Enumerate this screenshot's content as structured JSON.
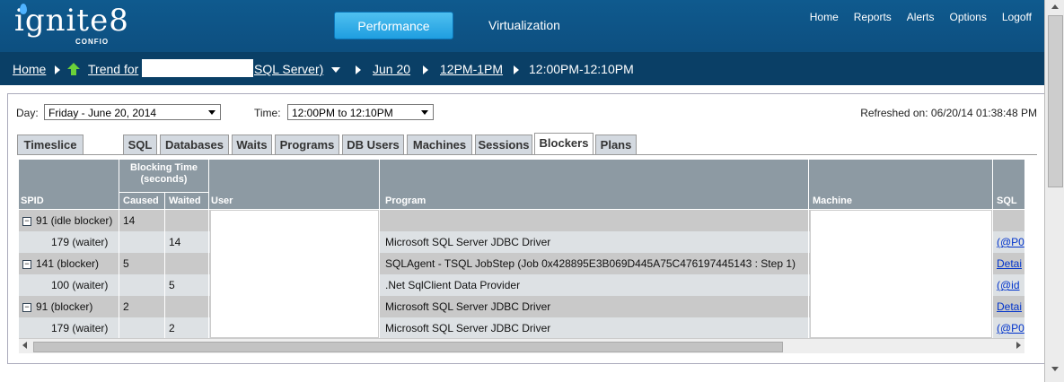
{
  "logo": {
    "word": "ignite8",
    "sub": "CONFIO"
  },
  "nav": {
    "performance": "Performance",
    "virtualization": "Virtualization"
  },
  "top_links": [
    "Home",
    "Reports",
    "Alerts",
    "Options",
    "Logoff"
  ],
  "breadcrumb": {
    "home": "Home",
    "trend": "Trend for",
    "sql": "SQL Server)",
    "day": "Jun 20",
    "hour": "12PM-1PM",
    "slice": "12:00PM-12:10PM"
  },
  "filters": {
    "day_label": "Day:",
    "day_value": "Friday - June 20, 2014",
    "time_label": "Time:",
    "time_value": "12:00PM to 12:10PM",
    "refreshed": "Refreshed on: 06/20/14 01:38:48 PM"
  },
  "tabs": [
    "Timeslice",
    "SQL",
    "Databases",
    "Waits",
    "Programs",
    "DB Users",
    "Machines",
    "Sessions",
    "Blockers",
    "Plans"
  ],
  "active_tab": "Blockers",
  "columns": {
    "spid": "SPID",
    "blocking": "Blocking Time (seconds)",
    "caused": "Caused",
    "waited": "Waited",
    "user": "User",
    "program": "Program",
    "machine": "Machine",
    "sql": "SQL"
  },
  "rows": [
    {
      "spid": "91 (idle blocker)",
      "caused": "14",
      "waited": "",
      "program": "",
      "sql": "",
      "expand": true
    },
    {
      "spid": "179 (waiter)",
      "caused": "",
      "waited": "14",
      "program": "Microsoft SQL Server JDBC Driver",
      "sql": "(@P0",
      "expand": false
    },
    {
      "spid": "141 (blocker)",
      "caused": "5",
      "waited": "",
      "program": "SQLAgent - TSQL JobStep (Job 0x428895E3B069D445A75C476197445143 : Step 1)",
      "sql": "Detai",
      "expand": true
    },
    {
      "spid": "100 (waiter)",
      "caused": "",
      "waited": "5",
      "program": ".Net SqlClient Data Provider",
      "sql": "(@id",
      "expand": false
    },
    {
      "spid": "91 (blocker)",
      "caused": "2",
      "waited": "",
      "program": "Microsoft SQL Server JDBC Driver",
      "sql": "Detai",
      "expand": true
    },
    {
      "spid": "179 (waiter)",
      "caused": "",
      "waited": "2",
      "program": "Microsoft SQL Server JDBC Driver",
      "sql": "(@P0",
      "expand": false
    }
  ]
}
